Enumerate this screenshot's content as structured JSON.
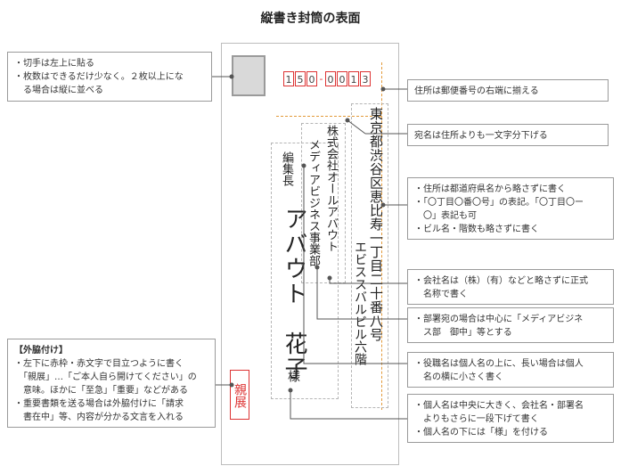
{
  "title": "縦書き封筒の表面",
  "zip_digits": [
    "1",
    "5",
    "0",
    "0",
    "0",
    "1",
    "3"
  ],
  "address": "東京都渋谷区恵比寿一丁目二十番八号",
  "building": "エビススバルビル六階",
  "company": "株式会社オールアバウト",
  "department": "メディアビジネス事業部",
  "position": "編集長",
  "recipient": "アバウト　花子",
  "honorific": "様",
  "stamp_mark": "親展",
  "notes": {
    "stamp": [
      "・切手は左上に貼る",
      "・枚数はできるだけ少なく。２枚以上にな",
      "　る場合は縦に並べる"
    ],
    "address_align": [
      "住所は郵便番号の右端に揃える"
    ],
    "addressee_offset": [
      "宛名は住所よりも一文字分下げる"
    ],
    "address_rules": [
      "・住所は都道府県名から略さずに書く",
      "・「〇丁目〇番〇号」の表記。「〇丁目〇ー",
      "　〇」表記も可",
      "・ビル名・階数も略さずに書く"
    ],
    "company_rule": [
      "・会社名は（株）（有）などと略さずに正式",
      "　名称で書く"
    ],
    "dept_rule": [
      "・部署宛の場合は中心に「メディアビジネ",
      "　ス部　御中」等とする"
    ],
    "title_rule": [
      "・役職名は個人名の上に、長い場合は個人",
      "　名の横に小さく書く"
    ],
    "name_rule": [
      "・個人名は中央に大きく、会社名・部署名",
      "　よりもさらに一段下げて書く",
      "・個人名の下には「様」を付ける"
    ],
    "side_notes": [
      "【外脇付け】",
      "・左下に赤枠・赤文字で目立つように書く",
      "　「親展」…「ご本人自ら開けてください」の",
      "　意味。ほかに「至急」「重要」などがある",
      "・重要書類を送る場合は外脇付けに「請求",
      "　書在中」等、内容が分かる文言を入れる"
    ]
  }
}
